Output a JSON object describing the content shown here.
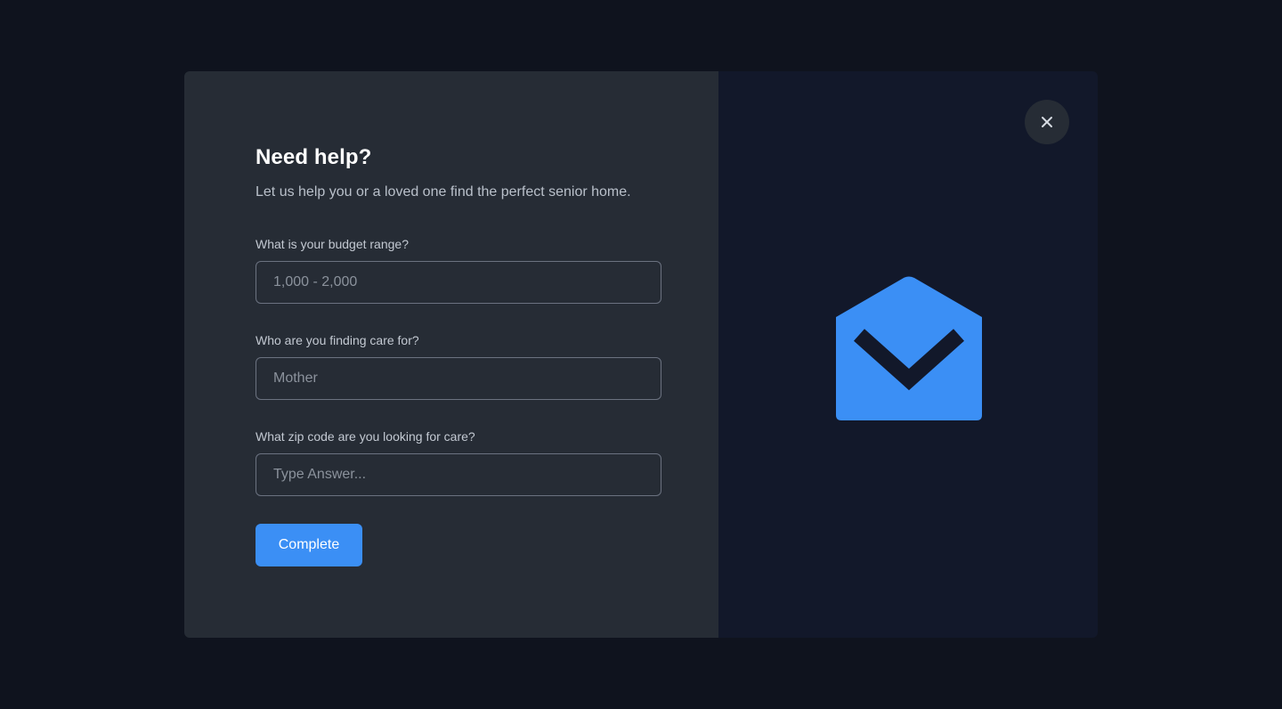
{
  "modal": {
    "title": "Need help?",
    "subtitle": "Let us help you or a loved one find the perfect senior home.",
    "fields": [
      {
        "label": "What is your budget range?",
        "placeholder": "1,000 - 2,000",
        "value": ""
      },
      {
        "label": "Who are you finding care for?",
        "placeholder": "Mother",
        "value": ""
      },
      {
        "label": "What zip code are you looking for care?",
        "placeholder": "Type Answer...",
        "value": ""
      }
    ],
    "submit_label": "Complete",
    "close_icon": "close-icon",
    "illustration_icon": "open-envelope-icon"
  },
  "colors": {
    "page_background": "#0f131e",
    "form_panel": "#262c35",
    "art_panel": "#12182a",
    "accent": "#3b8ff5"
  }
}
